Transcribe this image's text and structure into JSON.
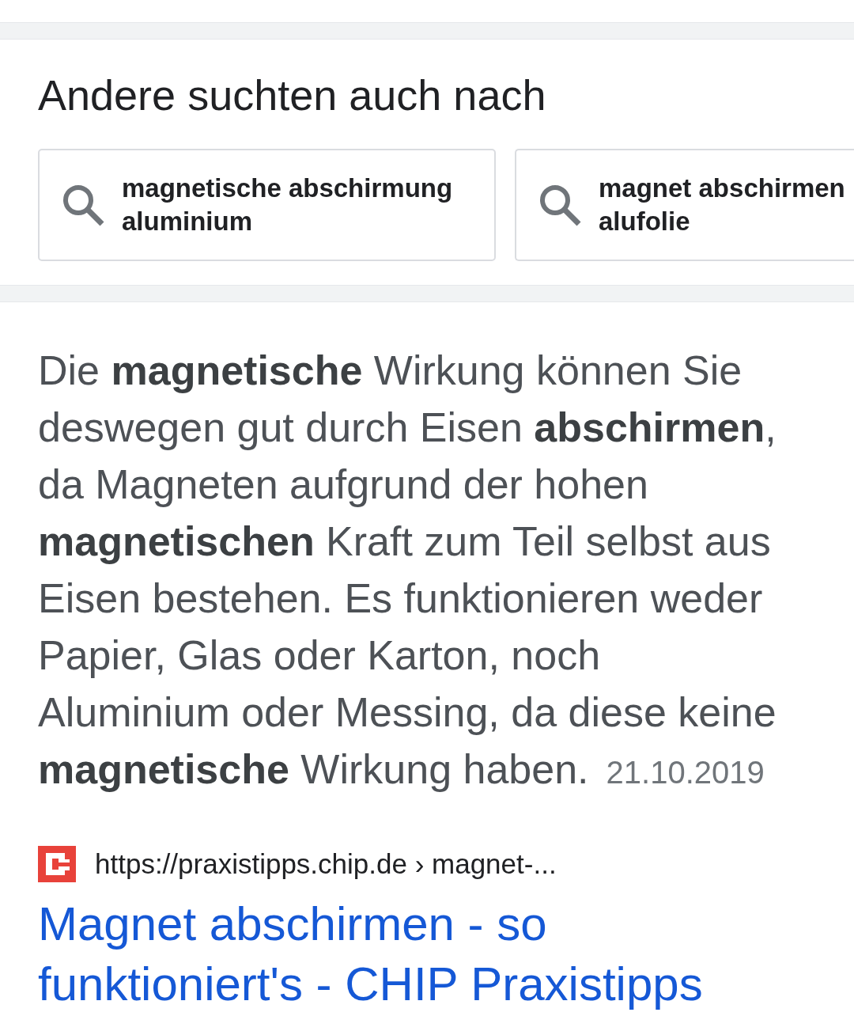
{
  "related_searches": {
    "title": "Andere suchten auch nach",
    "items": [
      {
        "text": "magnetische abschirmung aluminium"
      },
      {
        "text": "magnet abschirmen alufolie"
      }
    ]
  },
  "snippet": {
    "text": "Die **magnetische** Wirkung können Sie deswegen gut durch Eisen **abschirmen**, da Magneten aufgrund der hohen **magnetischen** Kraft zum Teil selbst aus Eisen bestehen. Es funktionieren weder Papier, Glas oder Karton, noch Aluminium oder Messing, da diese keine **magnetische** Wirkung haben.",
    "date": "21.10.2019"
  },
  "result": {
    "url": "https://praxistipps.chip.de › magnet-...",
    "title": "Magnet abschirmen - so funktioniert's - CHIP Praxistipps"
  }
}
